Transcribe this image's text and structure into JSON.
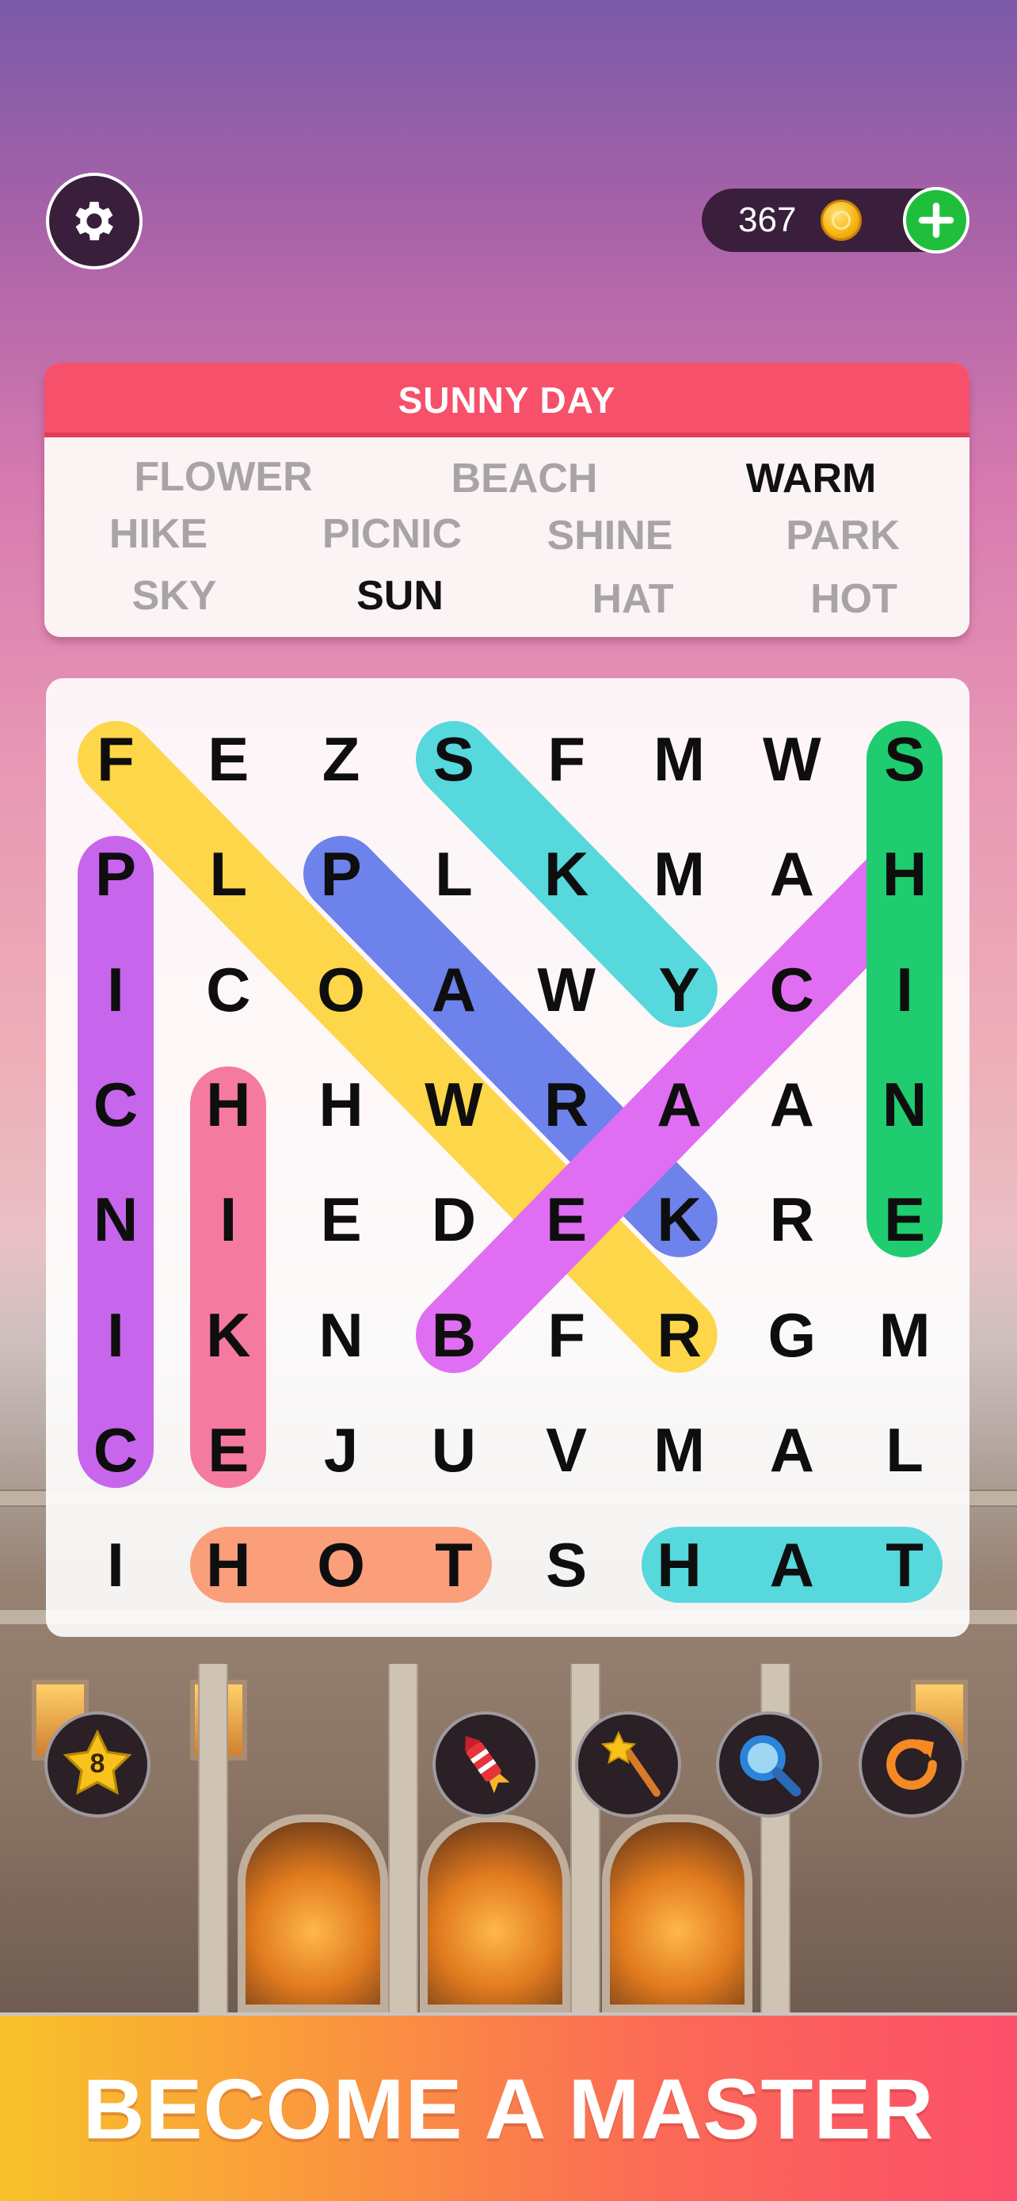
{
  "coins": {
    "count": "367"
  },
  "puzzle": {
    "theme": "SUNNY DAY",
    "words": [
      {
        "text": "FLOWER",
        "found": false
      },
      {
        "text": "BEACH",
        "found": false
      },
      {
        "text": "WARM",
        "found": false
      },
      {
        "text": "HIKE",
        "found": true
      },
      {
        "text": "PICNIC",
        "found": true
      },
      {
        "text": "SHINE",
        "found": true
      },
      {
        "text": "PARK",
        "found": true
      },
      {
        "text": "SKY",
        "found": true
      },
      {
        "text": "SUN",
        "found": false
      },
      {
        "text": "HAT",
        "found": true
      },
      {
        "text": "HOT",
        "found": true
      }
    ],
    "grid": [
      [
        "F",
        "E",
        "Z",
        "S",
        "F",
        "M",
        "W",
        "S"
      ],
      [
        "P",
        "L",
        "P",
        "L",
        "K",
        "M",
        "A",
        "H"
      ],
      [
        "I",
        "C",
        "O",
        "A",
        "W",
        "Y",
        "C",
        "I"
      ],
      [
        "C",
        "H",
        "H",
        "W",
        "R",
        "A",
        "A",
        "N"
      ],
      [
        "N",
        "I",
        "E",
        "D",
        "E",
        "K",
        "R",
        "E"
      ],
      [
        "I",
        "K",
        "N",
        "B",
        "F",
        "R",
        "G",
        "M"
      ],
      [
        "C",
        "E",
        "J",
        "U",
        "V",
        "M",
        "A",
        "L"
      ],
      [
        "I",
        "H",
        "O",
        "T",
        "S",
        "H",
        "A",
        "T"
      ]
    ],
    "highlights": [
      {
        "word": "FLOWER",
        "from": [
          0,
          0
        ],
        "to": [
          5,
          5
        ],
        "color": "#fdd64a"
      },
      {
        "word": "PARK",
        "from": [
          1,
          2
        ],
        "to": [
          4,
          5
        ],
        "color": "#6d82ea"
      },
      {
        "word": "SKY",
        "from": [
          0,
          3
        ],
        "to": [
          2,
          5
        ],
        "color": "#56d8dc"
      },
      {
        "word": "BEACH",
        "from": [
          5,
          3
        ],
        "to": [
          1,
          7
        ],
        "color": "#e06ef2"
      },
      {
        "word": "SHINE",
        "from": [
          0,
          7
        ],
        "to": [
          4,
          7
        ],
        "color": "#1fcc70"
      },
      {
        "word": "PICNIC",
        "from": [
          1,
          0
        ],
        "to": [
          6,
          0
        ],
        "color": "#c766ec"
      },
      {
        "word": "HIKE",
        "from": [
          3,
          1
        ],
        "to": [
          6,
          1
        ],
        "color": "#f57aa0"
      },
      {
        "word": "HOT",
        "from": [
          7,
          1
        ],
        "to": [
          7,
          3
        ],
        "color": "#fb9e7a"
      },
      {
        "word": "HAT",
        "from": [
          7,
          5
        ],
        "to": [
          7,
          7
        ],
        "color": "#56d8dc"
      }
    ]
  },
  "tools": {
    "stars_count": "8"
  },
  "banner": {
    "text": "BECOME A MASTER"
  }
}
